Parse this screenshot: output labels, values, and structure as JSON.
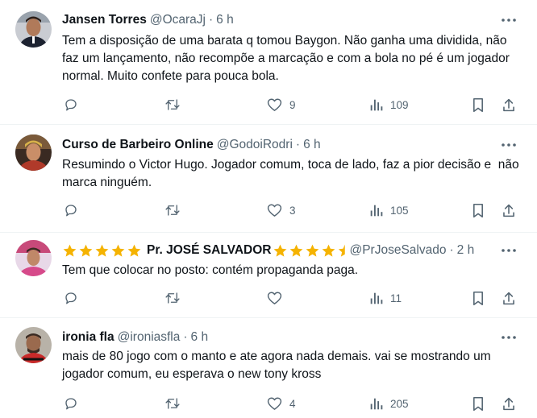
{
  "tweets": [
    {
      "name": "Jansen Torres",
      "handle": "@OcaraJj",
      "time": "6 h",
      "text": "Tem a disposição de uma barata q tomou Baygon. Não ganha uma dividida, não faz um lançamento, não recompõe a marcação e com a bola no pé é um jogador normal. Muito confete para pouca bola.",
      "replies": "",
      "retweets": "",
      "likes": "9",
      "views": "109"
    },
    {
      "name": "Curso de Barbeiro Online",
      "handle": "@GodoiRodri",
      "time": "6 h",
      "text": "Resumindo o Victor Hugo. Jogador comum, toca de lado, faz a pior decisão e  não marca ninguém.",
      "replies": "",
      "retweets": "",
      "likes": "3",
      "views": "105"
    },
    {
      "name": "Pr. JOSÉ SALVADOR",
      "handle": "@PrJoseSalvado",
      "time": "2 h",
      "text": "Tem que colocar no posto: contém propaganda paga.",
      "replies": "",
      "retweets": "",
      "likes": "",
      "views": "11"
    },
    {
      "name": "ironia fla",
      "handle": "@ironiasfla",
      "time": "6 h",
      "text": "mais de 80 jogo com o manto e ate agora nada demais. vai se mostrando um jogador comum, eu esperava o new tony kross",
      "replies": "",
      "retweets": "",
      "likes": "4",
      "views": "205"
    }
  ],
  "separator": "·",
  "colors": {
    "text": "#0f1419",
    "secondary": "#536471",
    "border": "#eff3f4",
    "star": "#f5b301"
  },
  "icons": [
    "reply-icon",
    "retweet-icon",
    "like-icon",
    "views-icon",
    "bookmark-icon",
    "share-icon",
    "more-icon",
    "star-icon"
  ]
}
